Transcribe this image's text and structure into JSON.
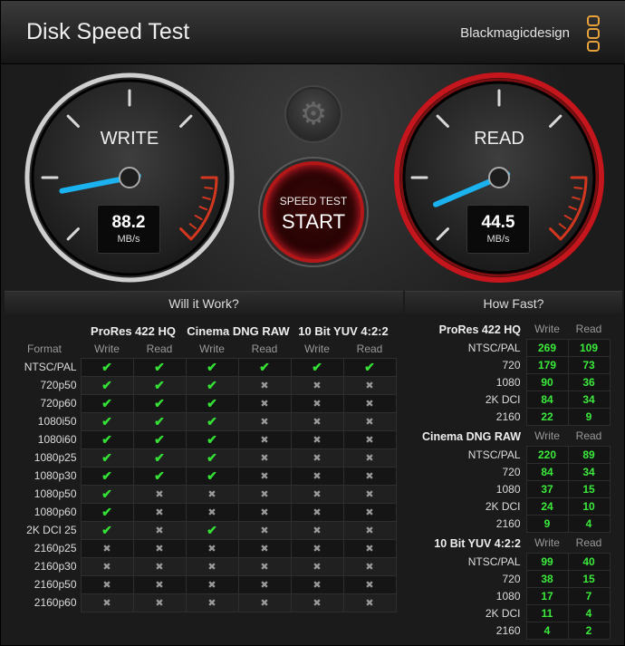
{
  "window": {
    "title": "Disk Speed Test",
    "brand": "Blackmagicdesign"
  },
  "gauges": {
    "write": {
      "label": "WRITE",
      "value": "88.2",
      "unit": "MB/s"
    },
    "read": {
      "label": "READ",
      "value": "44.5",
      "unit": "MB/s"
    }
  },
  "controls": {
    "settings_icon": "gear-icon",
    "start_top": "SPEED TEST",
    "start_main": "START"
  },
  "will_it_work": {
    "title": "Will it Work?",
    "groups": [
      "ProRes 422 HQ",
      "Cinema DNG RAW",
      "10 Bit YUV 4:2:2"
    ],
    "format_label": "Format",
    "write_label": "Write",
    "read_label": "Read",
    "rows": [
      {
        "format": "NTSC/PAL",
        "support": [
          true,
          true,
          true,
          true,
          true,
          true
        ]
      },
      {
        "format": "720p50",
        "support": [
          true,
          true,
          true,
          false,
          false,
          false
        ]
      },
      {
        "format": "720p60",
        "support": [
          true,
          true,
          true,
          false,
          false,
          false
        ]
      },
      {
        "format": "1080i50",
        "support": [
          true,
          true,
          true,
          false,
          false,
          false
        ]
      },
      {
        "format": "1080i60",
        "support": [
          true,
          true,
          true,
          false,
          false,
          false
        ]
      },
      {
        "format": "1080p25",
        "support": [
          true,
          true,
          true,
          false,
          false,
          false
        ]
      },
      {
        "format": "1080p30",
        "support": [
          true,
          true,
          true,
          false,
          false,
          false
        ]
      },
      {
        "format": "1080p50",
        "support": [
          true,
          false,
          false,
          false,
          false,
          false
        ]
      },
      {
        "format": "1080p60",
        "support": [
          true,
          false,
          false,
          false,
          false,
          false
        ]
      },
      {
        "format": "2K DCI 25",
        "support": [
          true,
          false,
          true,
          false,
          false,
          false
        ]
      },
      {
        "format": "2160p25",
        "support": [
          false,
          false,
          false,
          false,
          false,
          false
        ]
      },
      {
        "format": "2160p30",
        "support": [
          false,
          false,
          false,
          false,
          false,
          false
        ]
      },
      {
        "format": "2160p50",
        "support": [
          false,
          false,
          false,
          false,
          false,
          false
        ]
      },
      {
        "format": "2160p60",
        "support": [
          false,
          false,
          false,
          false,
          false,
          false
        ]
      }
    ]
  },
  "how_fast": {
    "title": "How Fast?",
    "write_label": "Write",
    "read_label": "Read",
    "groups": [
      {
        "name": "ProRes 422 HQ",
        "rows": [
          {
            "format": "NTSC/PAL",
            "write": "269",
            "read": "109"
          },
          {
            "format": "720",
            "write": "179",
            "read": "73"
          },
          {
            "format": "1080",
            "write": "90",
            "read": "36"
          },
          {
            "format": "2K DCI",
            "write": "84",
            "read": "34"
          },
          {
            "format": "2160",
            "write": "22",
            "read": "9"
          }
        ]
      },
      {
        "name": "Cinema DNG RAW",
        "rows": [
          {
            "format": "NTSC/PAL",
            "write": "220",
            "read": "89"
          },
          {
            "format": "720",
            "write": "84",
            "read": "34"
          },
          {
            "format": "1080",
            "write": "37",
            "read": "15"
          },
          {
            "format": "2K DCI",
            "write": "24",
            "read": "10"
          },
          {
            "format": "2160",
            "write": "9",
            "read": "4"
          }
        ]
      },
      {
        "name": "10 Bit YUV 4:2:2",
        "rows": [
          {
            "format": "NTSC/PAL",
            "write": "99",
            "read": "40"
          },
          {
            "format": "720",
            "write": "38",
            "read": "15"
          },
          {
            "format": "1080",
            "write": "17",
            "read": "7"
          },
          {
            "format": "2K DCI",
            "write": "11",
            "read": "4"
          },
          {
            "format": "2160",
            "write": "4",
            "read": "2"
          }
        ]
      }
    ]
  },
  "colors": {
    "accent": "#1ab3f0",
    "ok": "#35e035",
    "start_ring": "#b31717",
    "read_ring": "#c4161c"
  }
}
